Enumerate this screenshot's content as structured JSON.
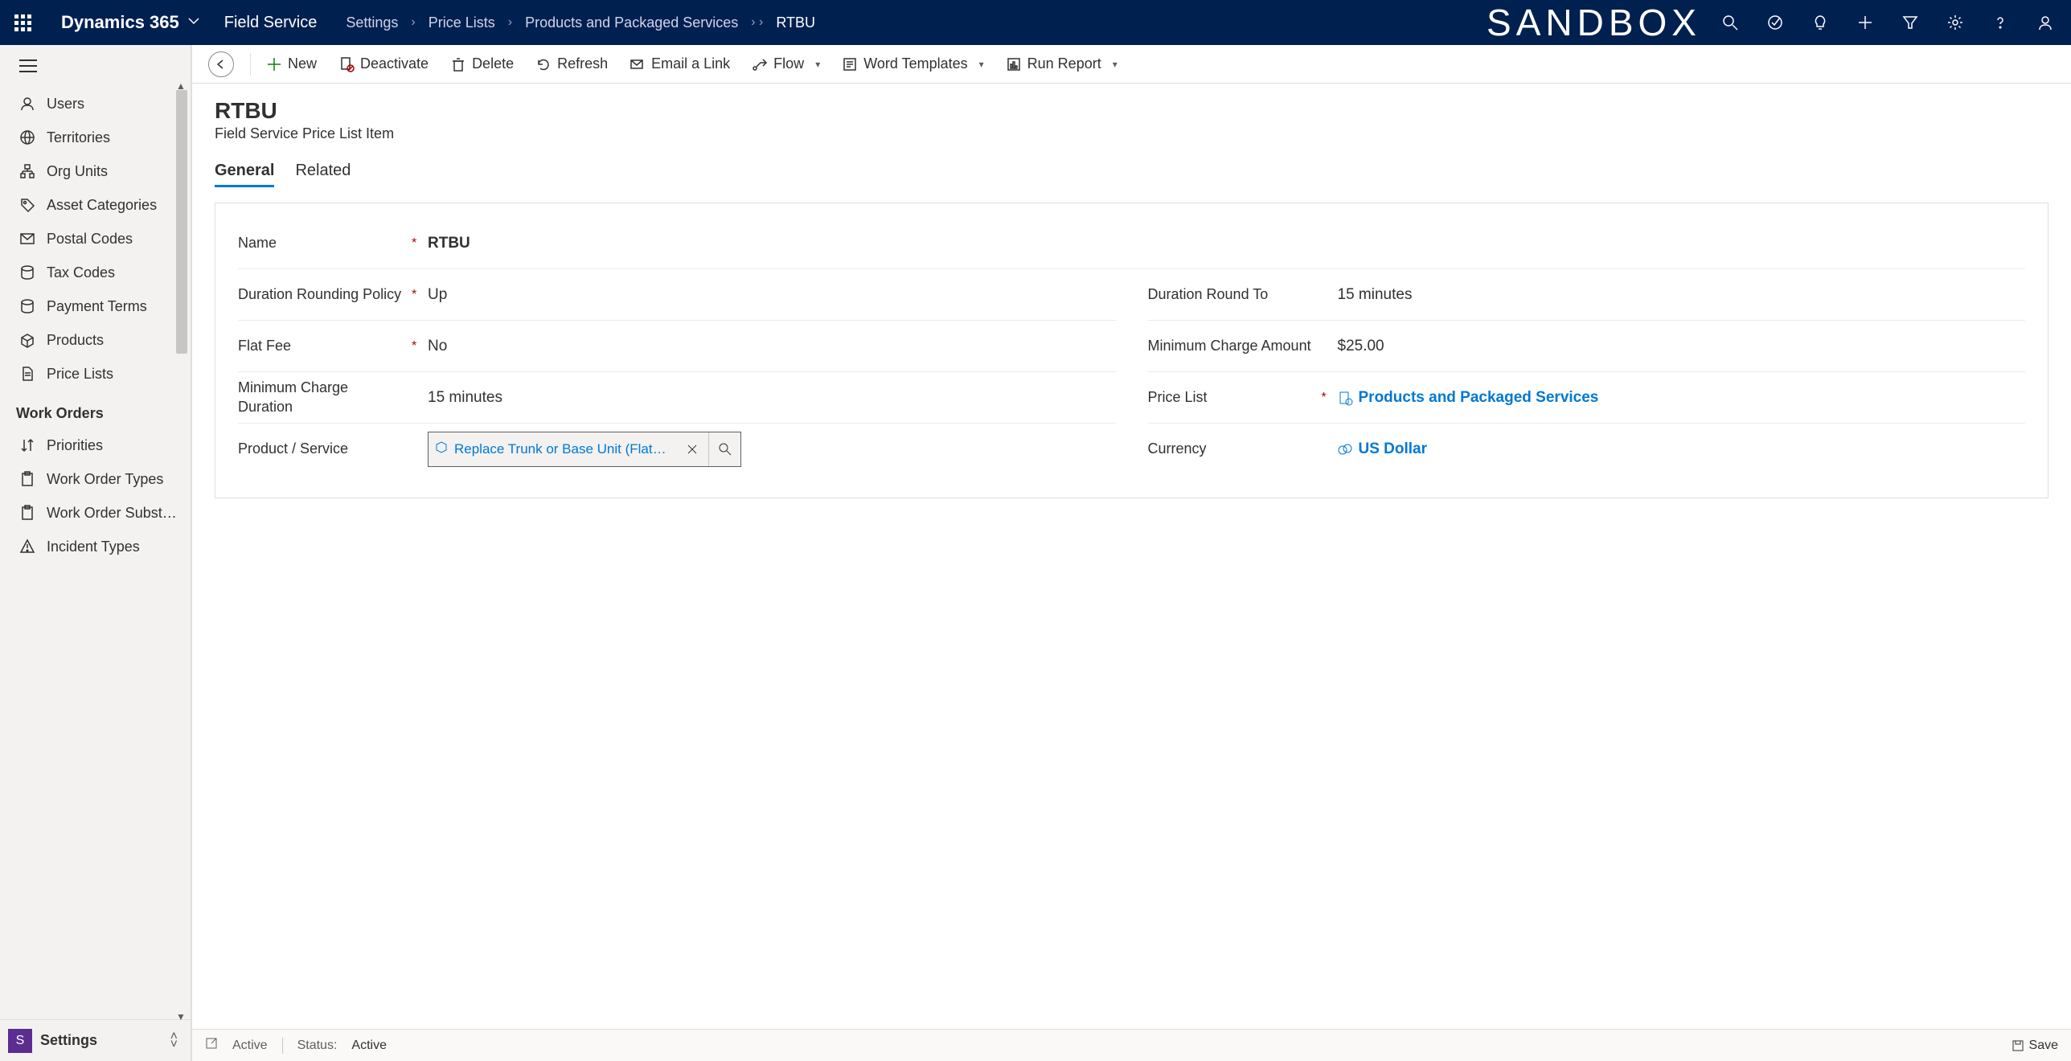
{
  "header": {
    "brand": "Dynamics 365",
    "app": "Field Service",
    "breadcrumbs": [
      "Settings",
      "Price Lists",
      "Products and Packaged Services",
      "RTBU"
    ],
    "sandbox": "SANDBOX"
  },
  "commands": {
    "new": "New",
    "deactivate": "Deactivate",
    "delete": "Delete",
    "refresh": "Refresh",
    "emailLink": "Email a Link",
    "flow": "Flow",
    "wordTemplates": "Word Templates",
    "runReport": "Run Report"
  },
  "sidebar": {
    "items": [
      "Users",
      "Territories",
      "Org Units",
      "Asset Categories",
      "Postal Codes",
      "Tax Codes",
      "Payment Terms",
      "Products",
      "Price Lists"
    ],
    "group": "Work Orders",
    "groupItems": [
      "Priorities",
      "Work Order Types",
      "Work Order Subst…",
      "Incident Types"
    ],
    "areaBadge": "S",
    "areaLabel": "Settings"
  },
  "record": {
    "title": "RTBU",
    "subtitle": "Field Service Price List Item",
    "tabs": [
      "General",
      "Related"
    ],
    "fields": {
      "name_label": "Name",
      "name_value": "RTBU",
      "durationPolicy_label": "Duration Rounding Policy",
      "durationPolicy_value": "Up",
      "durationRoundTo_label": "Duration Round To",
      "durationRoundTo_value": "15 minutes",
      "flatFee_label": "Flat Fee",
      "flatFee_value": "No",
      "minChargeAmount_label": "Minimum Charge Amount",
      "minChargeAmount_value": "$25.00",
      "minChargeDuration_label": "Minimum Charge Duration",
      "minChargeDuration_value": "15 minutes",
      "priceList_label": "Price List",
      "priceList_value": "Products and Packaged Services",
      "productService_label": "Product / Service",
      "productService_value": "Replace Trunk or Base Unit (Flat H…",
      "currency_label": "Currency",
      "currency_value": "US Dollar"
    }
  },
  "status": {
    "state": "Active",
    "statusLabel": "Status:",
    "statusValue": "Active",
    "save": "Save"
  }
}
